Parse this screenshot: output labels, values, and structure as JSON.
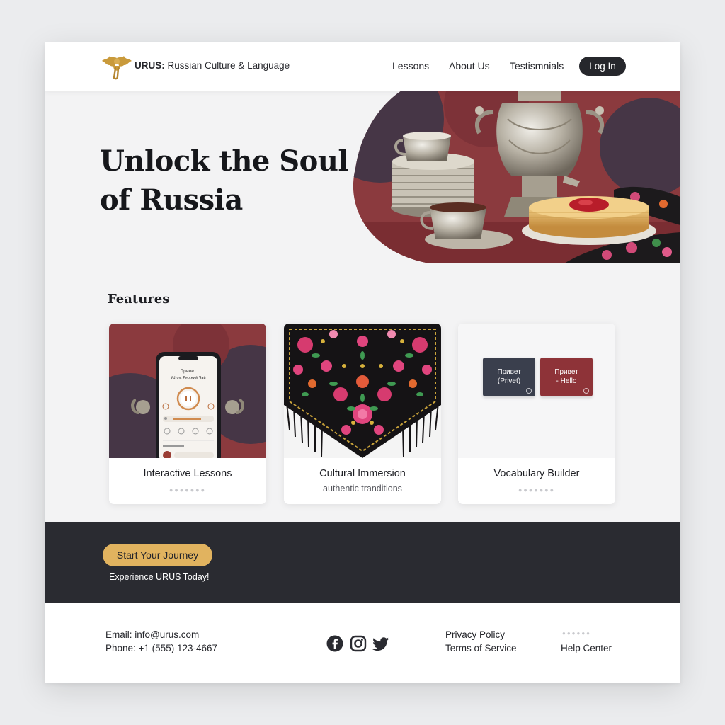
{
  "header": {
    "brand_name": "URUS:",
    "brand_tagline": "Russian Culture & Language",
    "nav": [
      "Lessons",
      "About Us",
      "Testismnials"
    ],
    "login_label": "Log In"
  },
  "hero": {
    "title_line1": "Unlock the Soul",
    "title_line2": "of Russia"
  },
  "features": {
    "title": "Features",
    "cards": [
      {
        "title": "Interactive Lessons",
        "phone_text1": "Привет",
        "phone_text2": "Уdrov. Русский Чай"
      },
      {
        "title": "Cultural Immersion",
        "subtitle": "authentic tranditions"
      },
      {
        "title": "Vocabulary Builder",
        "flashcards": [
          {
            "line1": "Привет",
            "line2": "(Privet)",
            "color": "#3a3f4d"
          },
          {
            "line1": "Привет",
            "line2": "- Hello",
            "color": "#8e3338"
          }
        ]
      }
    ]
  },
  "cta": {
    "button_label": "Start Your Journey",
    "subtitle": "Experience URUS Today!"
  },
  "footer": {
    "email": "Email: info@urus.com",
    "phone": "Phone: +1 (555) 123-4667",
    "social_icons": [
      "facebook-icon",
      "instagram-icon",
      "twitter-icon"
    ],
    "privacy": "Privacy Policy",
    "terms": "Terms of Service",
    "help": "Help Center"
  },
  "colors": {
    "accent_gold": "#e1b35f",
    "dark": "#2a2b31",
    "burgundy": "#8e3338",
    "plum": "#3f3346"
  }
}
